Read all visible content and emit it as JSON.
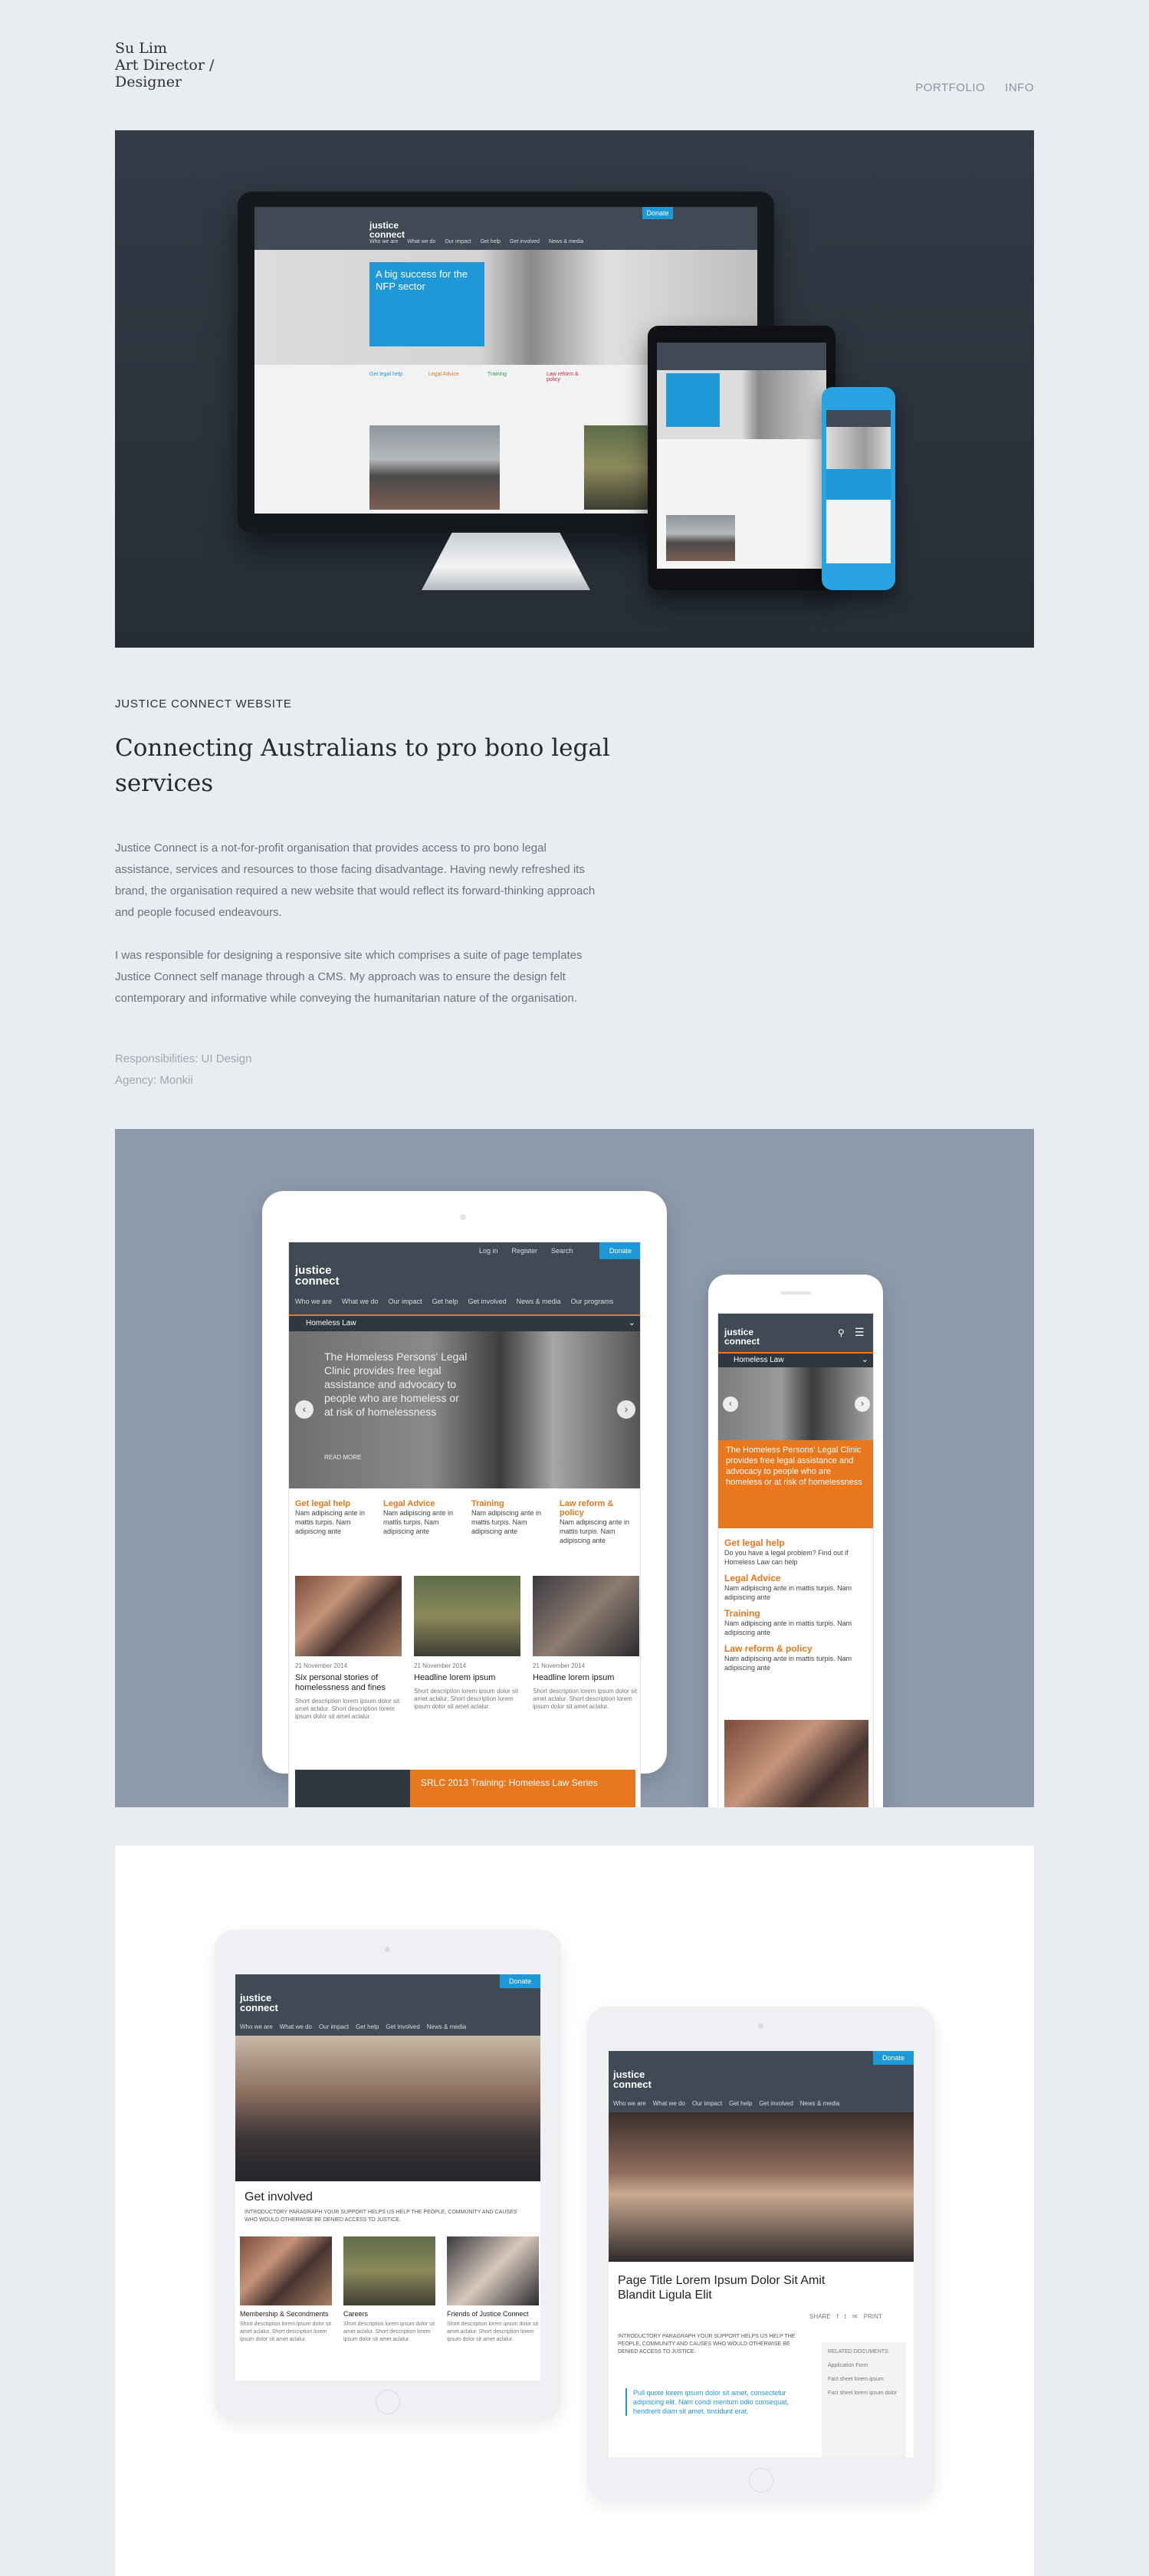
{
  "header": {
    "logo_line1": "Su Lim",
    "logo_line2": "Art Director /",
    "logo_line3": "Designer",
    "nav": [
      "PORTFOLIO",
      "INFO"
    ]
  },
  "project": {
    "eyebrow": "JUSTICE CONNECT WEBSITE",
    "title": "Connecting Australians to pro bono legal services",
    "para1": "Justice Connect is a not-for-profit organisation that provides access to pro bono legal assistance, services and resources to those facing disadvantage. Having newly refreshed its brand, the organisation required a new website that would reflect its forward-thinking approach and people focused endeavours.",
    "para2": "I was responsible for designing a responsive site which comprises a suite of page templates Justice Connect self manage through a CMS. My approach was to ensure the design felt contemporary and informative while conveying the humanitarian nature of the organisation.",
    "responsibilities": "Responsibilities: UI Design",
    "agency": "Agency: Monkii"
  },
  "mock": {
    "brand": "justice connect",
    "top_links": [
      "Log in",
      "Register",
      "Search"
    ],
    "donate": "Donate",
    "menu": [
      "Who we are",
      "What we do",
      "Our impact",
      "Get help",
      "Get involved",
      "News & media",
      "Our programs"
    ],
    "hero_text": "A big success for the NFP sector",
    "section_label": "Homeless Law",
    "slide_text": "The Homeless Persons' Legal Clinic provides free legal assistance and advocacy to people who are homeless or at risk of homelessness",
    "read_more": "READ MORE",
    "features": [
      "Get legal help",
      "Legal Advice",
      "Training",
      "Law reform & policy"
    ],
    "feature_copy": "Nam adipiscing ante in mattis turpis. Nam adipiscing ante",
    "date": "21 November 2014",
    "news": [
      "Six personal stories of homelessness and fines",
      "Headline lorem ipsum",
      "Headline lorem ipsum"
    ],
    "news_copy": "Short description lorem ipsum dolor sit amet aclalur. Short description lorem ipsum dolor sit amet aclalur.",
    "banner": "SRLC 2013 Training: Homeless Law Series",
    "phone_link1": "Do you have a legal problem? Find out if Homeless Law can help",
    "get_involved": "Get involved",
    "get_involved_intro": "INTRODUCTORY PARAGRAPH YOUR SUPPORT HELPS US HELP THE PEOPLE, COMMUNITY AND CAUSES WHO WOULD OTHERWISE BE DENIED ACCESS TO JUSTICE.",
    "cards": [
      "Membership & Secondments",
      "Careers",
      "Friends of Justice Connect"
    ],
    "page_title": "Page Title Lorem Ipsum Dolor Sit Amit Blandit Ligula Elit",
    "quote": "Pull quote lorem ipsum dolor sit amet, consectetur adipiscing elit. Nam condi mentum odio consequat, hendrerit diam sit amet, tincidunt erat.",
    "related": "RELATED DOCUMENTS",
    "docs": [
      "Application Form",
      "Fact sheet lorem ipsum",
      "Fact sheet lorem ipsum dolor"
    ],
    "share": "SHARE",
    "print": "PRINT"
  }
}
